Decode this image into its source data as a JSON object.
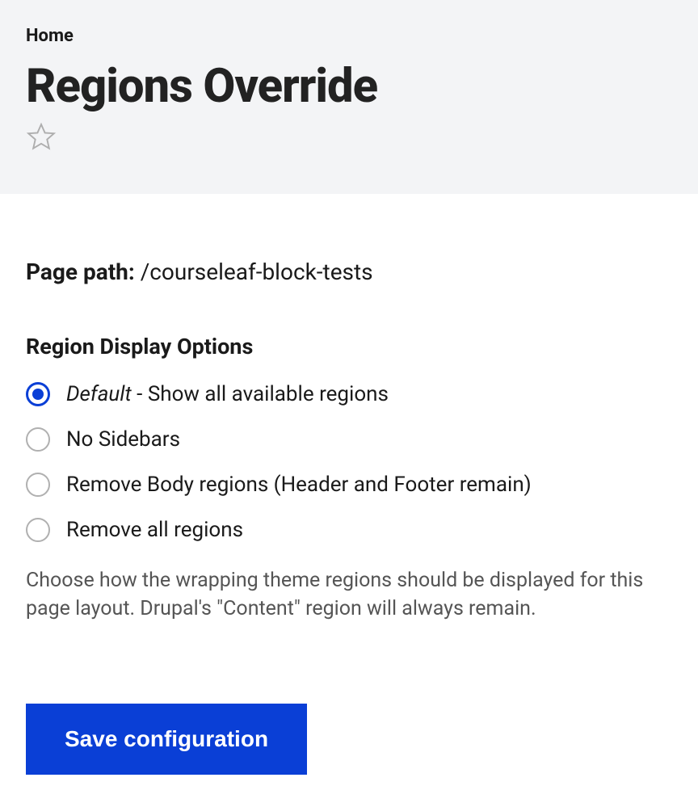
{
  "breadcrumb": "Home",
  "page_title": "Regions Override",
  "page_path": {
    "label": "Page path:",
    "value": "/courseleaf-block-tests"
  },
  "fieldset": {
    "legend": "Region Display Options",
    "options": [
      {
        "prefix": "Default",
        "separator": " - ",
        "rest": "Show all available regions"
      },
      {
        "label": "No Sidebars"
      },
      {
        "label": "Remove Body regions (Header and Footer remain)"
      },
      {
        "label": "Remove all regions"
      }
    ],
    "selected_index": 0,
    "help_text": "Choose how the wrapping theme regions should be displayed for this page layout. Drupal's \"Content\" region will always remain."
  },
  "actions": {
    "save_label": "Save configuration"
  }
}
